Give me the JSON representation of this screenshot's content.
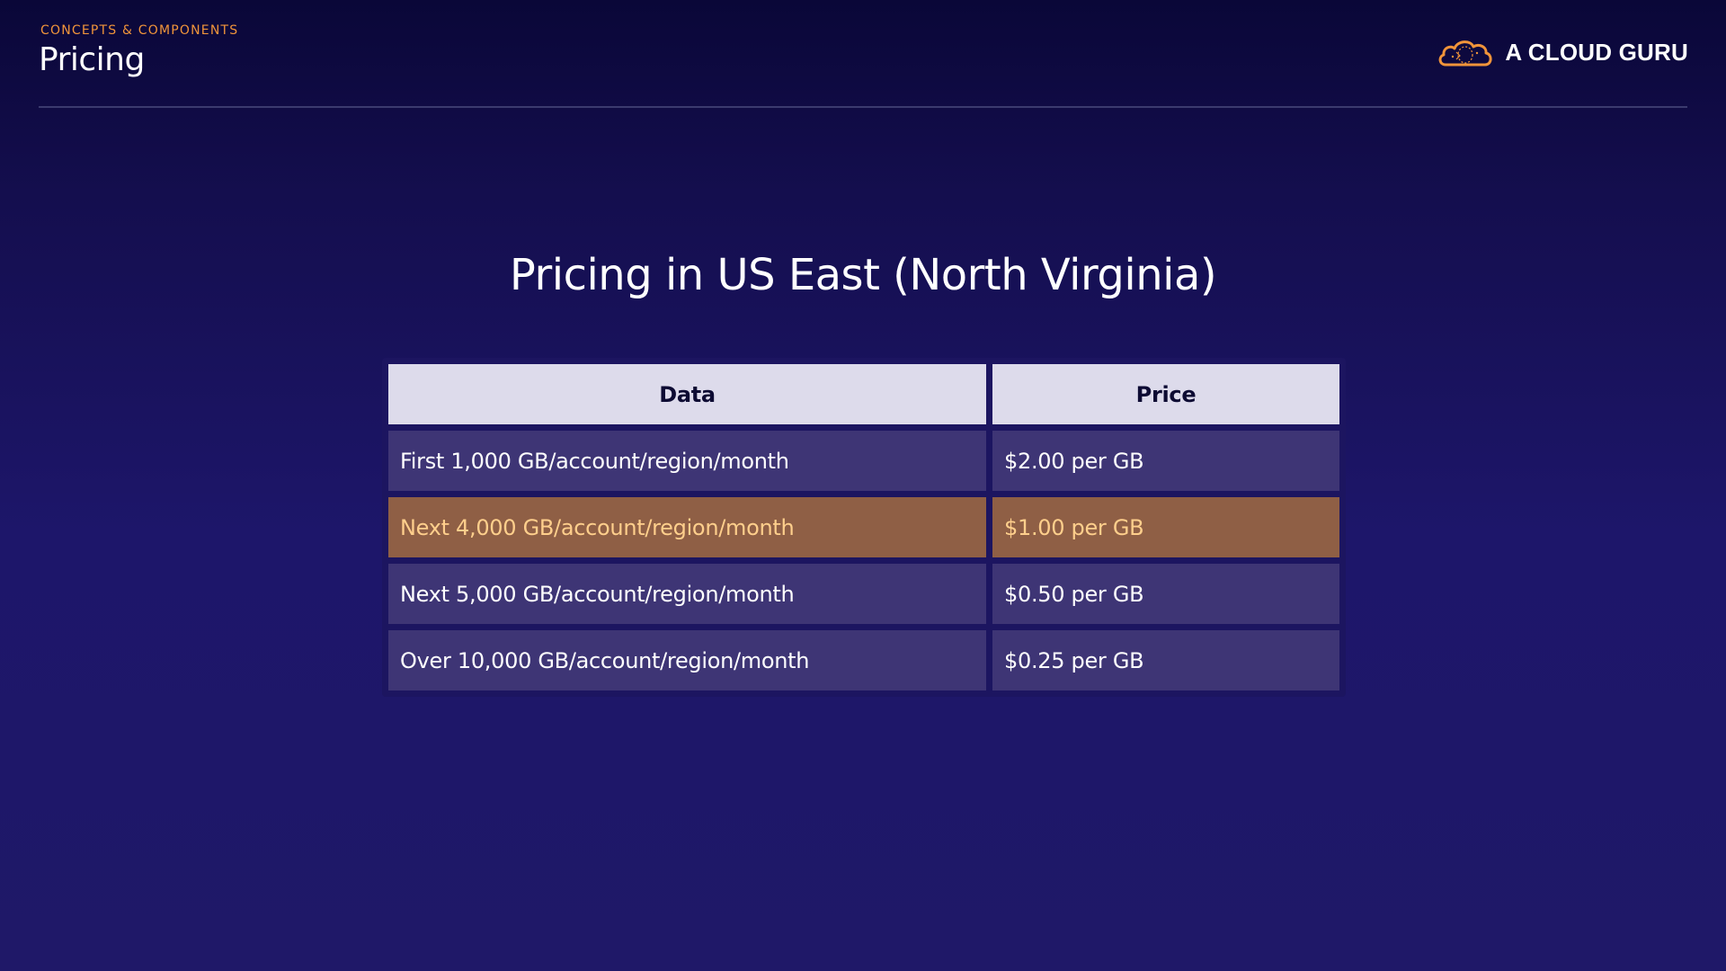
{
  "header": {
    "section_label": "CONCEPTS & COMPONENTS",
    "title": "Pricing",
    "brand_name": "A CLOUD GURU",
    "brand_logo_icon": "cloud-logo-icon"
  },
  "content": {
    "title": "Pricing in US East (North Virginia)"
  },
  "table": {
    "headers": [
      "Data",
      "Price"
    ],
    "rows": [
      {
        "data": "First 1,000 GB/account/region/month",
        "price": "$2.00 per GB"
      },
      {
        "data": "Next 4,000 GB/account/region/month",
        "price": "$1.00 per GB"
      },
      {
        "data": "Next 5,000 GB/account/region/month",
        "price": "$0.50 per GB"
      },
      {
        "data": "Over 10,000 GB/account/region/month",
        "price": "$0.25 per GB"
      }
    ]
  },
  "colors": {
    "accent_orange": "#f0943a",
    "highlight_row_bg": "#8f5f45",
    "highlight_row_text": "#ffcf8c",
    "table_header_bg": "#dddbeb",
    "table_row_bg": "#3e3575"
  }
}
